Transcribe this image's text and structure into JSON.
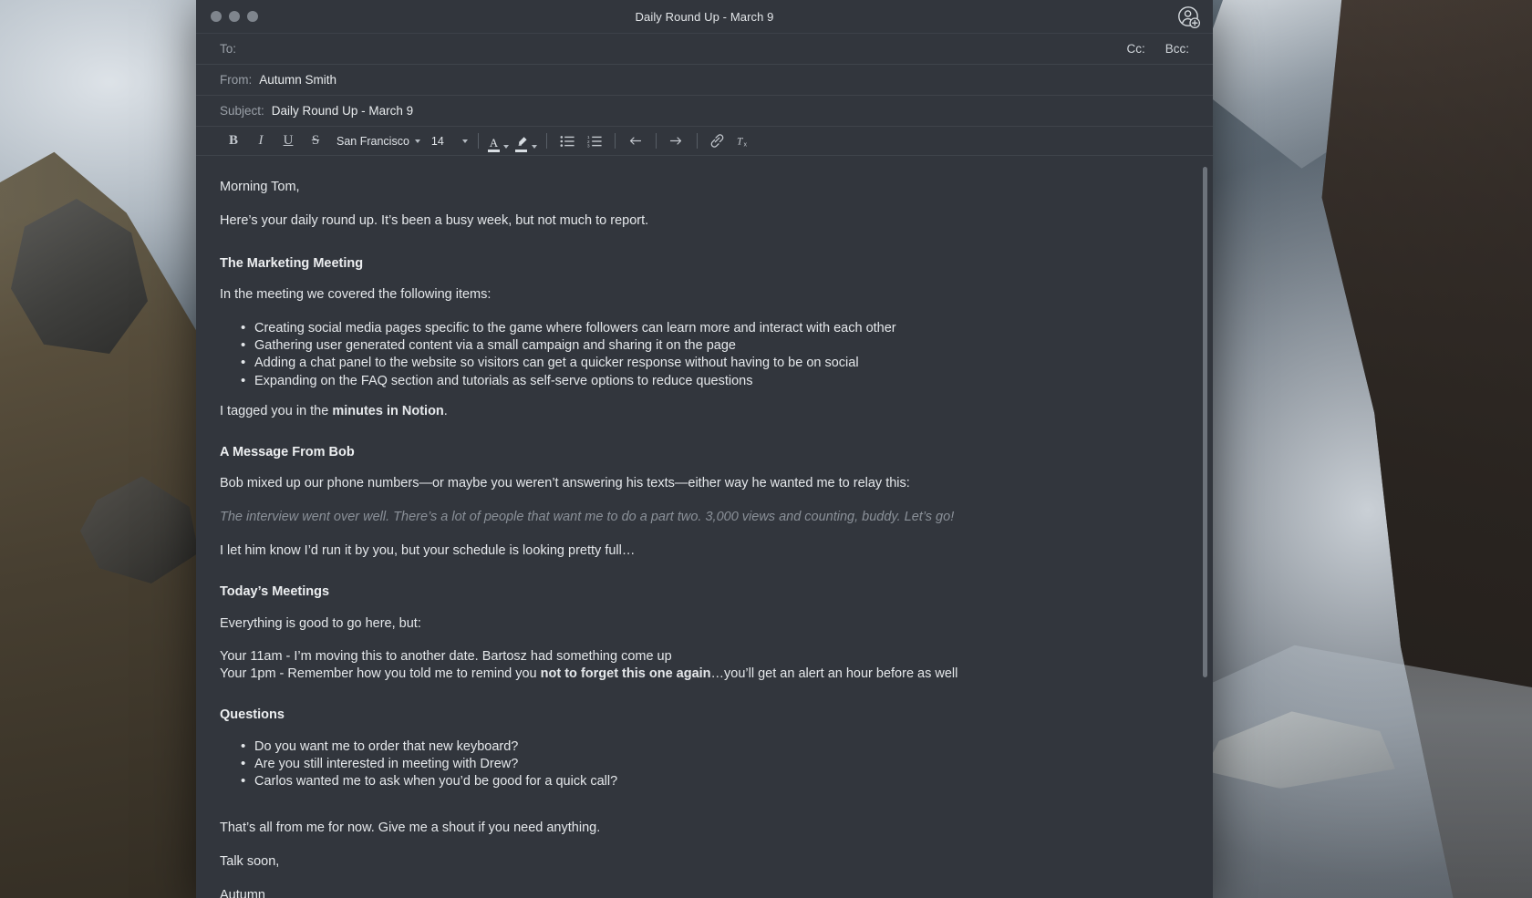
{
  "window": {
    "title": "Daily Round Up - March 9",
    "traffic_lights": [
      "close",
      "minimize",
      "maximize"
    ],
    "account_icon": "user-add-icon"
  },
  "header": {
    "to_label": "To:",
    "to_value": "",
    "to_placeholder": "",
    "cc_label": "Cc:",
    "bcc_label": "Bcc:",
    "from_label": "From:",
    "from_value": "Autumn Smith",
    "subject_label": "Subject:",
    "subject_value": "Daily Round Up - March 9"
  },
  "toolbar": {
    "bold": "B",
    "italic": "I",
    "underline": "U",
    "strikethrough": "S",
    "font_family": "San Francisco",
    "font_size": "14",
    "text_color_glyph": "A",
    "highlight_glyph": "pen-icon",
    "bulleted_list": "bulleted-list-icon",
    "numbered_list": "numbered-list-icon",
    "outdent": "outdent-icon",
    "indent": "indent-icon",
    "link": "link-icon",
    "clear_formatting": "clear-formatting-icon"
  },
  "body": {
    "greeting": "Morning Tom,",
    "intro": "Here’s your daily round up. It’s been a busy week, but not much to report.",
    "section1_heading": "The Marketing Meeting",
    "section1_intro": "In the meeting we covered the following items:",
    "section1_bullets": [
      "Creating social media pages specific to the game where followers can learn more and interact with each other",
      "Gathering user generated content via a small campaign and sharing it on the page",
      "Adding a chat panel to the website so visitors can get a quicker response without having to be on social",
      "Expanding on the FAQ section and tutorials as self-serve options to reduce questions"
    ],
    "section1_note_prefix": "I tagged you in the ",
    "section1_note_bold": "minutes in Notion",
    "section1_note_suffix": ".",
    "section2_heading": "A Message From Bob",
    "section2_intro": "Bob mixed up our phone numbers—or maybe you weren’t answering his texts—either way he wanted me to relay this:",
    "section2_quote": "The interview went over well. There’s a lot of people that want me to do a part two. 3,000 views and counting, buddy. Let’s go!",
    "section2_followup": "I let him know I’d run it by you, but your schedule is looking pretty full…",
    "section3_heading": "Today’s Meetings",
    "section3_intro": "Everything is good to go here, but:",
    "section3_line1": "Your 11am - I’m moving this to another date. Bartosz had something come up",
    "section3_line2_prefix": "Your 1pm - Remember how you told me to remind you ",
    "section3_line2_bold": "not to forget this one again",
    "section3_line2_suffix": "…you’ll get an alert an hour before as well",
    "section4_heading": "Questions",
    "section4_bullets": [
      "Do you want me to order that new keyboard?",
      "Are you still interested in meeting with Drew?",
      "Carlos wanted me to ask when you’d be good for a quick call?"
    ],
    "closing1": "That’s all from me for now. Give me a shout if you need anything.",
    "closing2": "Talk soon,",
    "signature": "Autumn"
  },
  "colors": {
    "window_bg": "#32363d",
    "text_primary": "#e5e8eb",
    "text_muted": "#9aa0a8",
    "quote_text": "#8a9098",
    "divider": "#3f444b"
  }
}
